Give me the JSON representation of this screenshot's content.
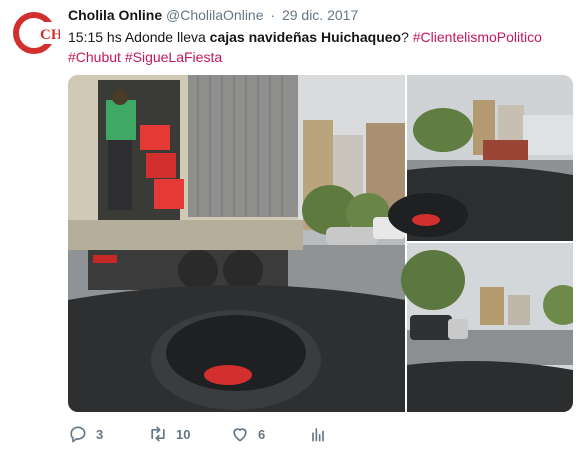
{
  "author": {
    "name": "Cholila Online",
    "handle": "@CholilaOnline",
    "separator": "·",
    "date": "29 dic. 2017",
    "avatar_text": "CHO",
    "avatar_color": "#d32f2f"
  },
  "tweet": {
    "text_plain_1": "15:15 hs Adonde lleva ",
    "text_bold": "cajas navideñas Huichaqueo",
    "text_plain_2": "? ",
    "hashtags": [
      "#ClientelismoPolitico",
      "#Chubut",
      "#SigueLaFiesta"
    ]
  },
  "actions": {
    "replies": "3",
    "retweets": "10",
    "likes": "6"
  },
  "colors": {
    "hashtag": "#c2185b",
    "meta": "#657786"
  },
  "icons": [
    "reply-icon",
    "retweet-icon",
    "like-icon",
    "analytics-icon"
  ]
}
